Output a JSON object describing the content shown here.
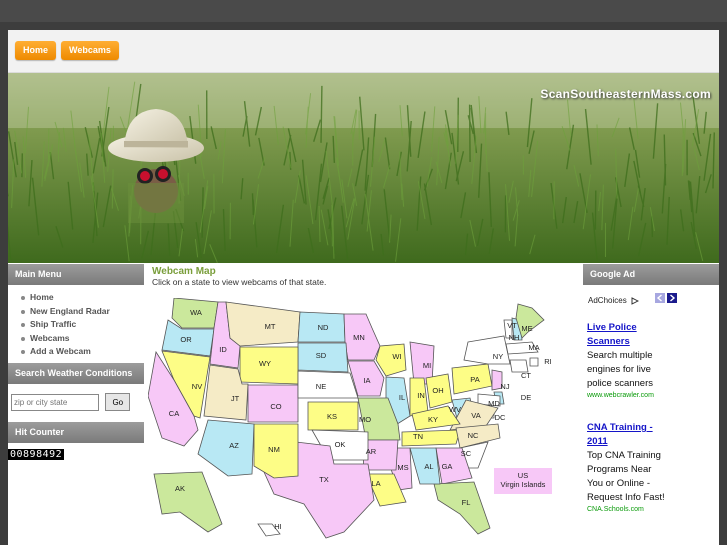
{
  "nav": {
    "items": [
      {
        "label": "Home"
      },
      {
        "label": "Webcams"
      }
    ]
  },
  "banner": {
    "site_title": "ScanSoutheasternMass.com"
  },
  "sidebar": {
    "main_menu_title": "Main Menu",
    "menu_items": [
      {
        "label": "Home"
      },
      {
        "label": "New England Radar"
      },
      {
        "label": "Ship Traffic"
      },
      {
        "label": "Webcams"
      },
      {
        "label": "Add a Webcam"
      }
    ],
    "weather_title": "Search Weather Conditions",
    "search_placeholder": "zip or city state",
    "go_label": "Go",
    "counter_title": "Hit Counter",
    "counter_value": "00898492"
  },
  "main": {
    "title": "Webcam Map",
    "subtitle": "Click on a state to view webcams of that state.",
    "states": [
      "WA",
      "OR",
      "ID",
      "MT",
      "ND",
      "MN",
      "WI",
      "MI",
      "SD",
      "WY",
      "NV",
      "CA",
      "JT",
      "CO",
      "NE",
      "IA",
      "IL",
      "IN",
      "OH",
      "PA",
      "NY",
      "VT",
      "NH",
      "ME",
      "MA",
      "RI",
      "CT",
      "NJ",
      "DE",
      "MD",
      "DC",
      "WV",
      "VA",
      "KY",
      "KS",
      "MO",
      "TN",
      "NC",
      "SC",
      "GA",
      "FL",
      "AL",
      "MS",
      "LA",
      "AR",
      "OK",
      "TX",
      "NM",
      "AZ",
      "AK",
      "HI"
    ],
    "territory": [
      "US",
      "Virgin Islands"
    ]
  },
  "ads": {
    "header": "Google Ad",
    "adchoices": "AdChoices",
    "items": [
      {
        "title": [
          "Live Police",
          "Scanners"
        ],
        "body": [
          "Search multiple",
          "engines for live",
          "police scanners"
        ],
        "url": "www.webcrawler.com"
      },
      {
        "title": [
          "CNA Training -",
          "2011"
        ],
        "body": [
          "Top CNA Training",
          "Programs Near",
          "You or Online -",
          "Request Info Fast!"
        ],
        "url": "CNA.Schools.com"
      }
    ]
  },
  "colors": {
    "orange": "#f39400",
    "pink": "#f7c8f7",
    "cyan": "#b8e8f4",
    "yellow": "#fdfd86",
    "cream": "#f5ebc6",
    "green": "#cbe89c",
    "lavender": "#d8c8f5",
    "white": "#ffffff",
    "title_green": "#7a9e3b",
    "link_blue": "#1414c8"
  }
}
